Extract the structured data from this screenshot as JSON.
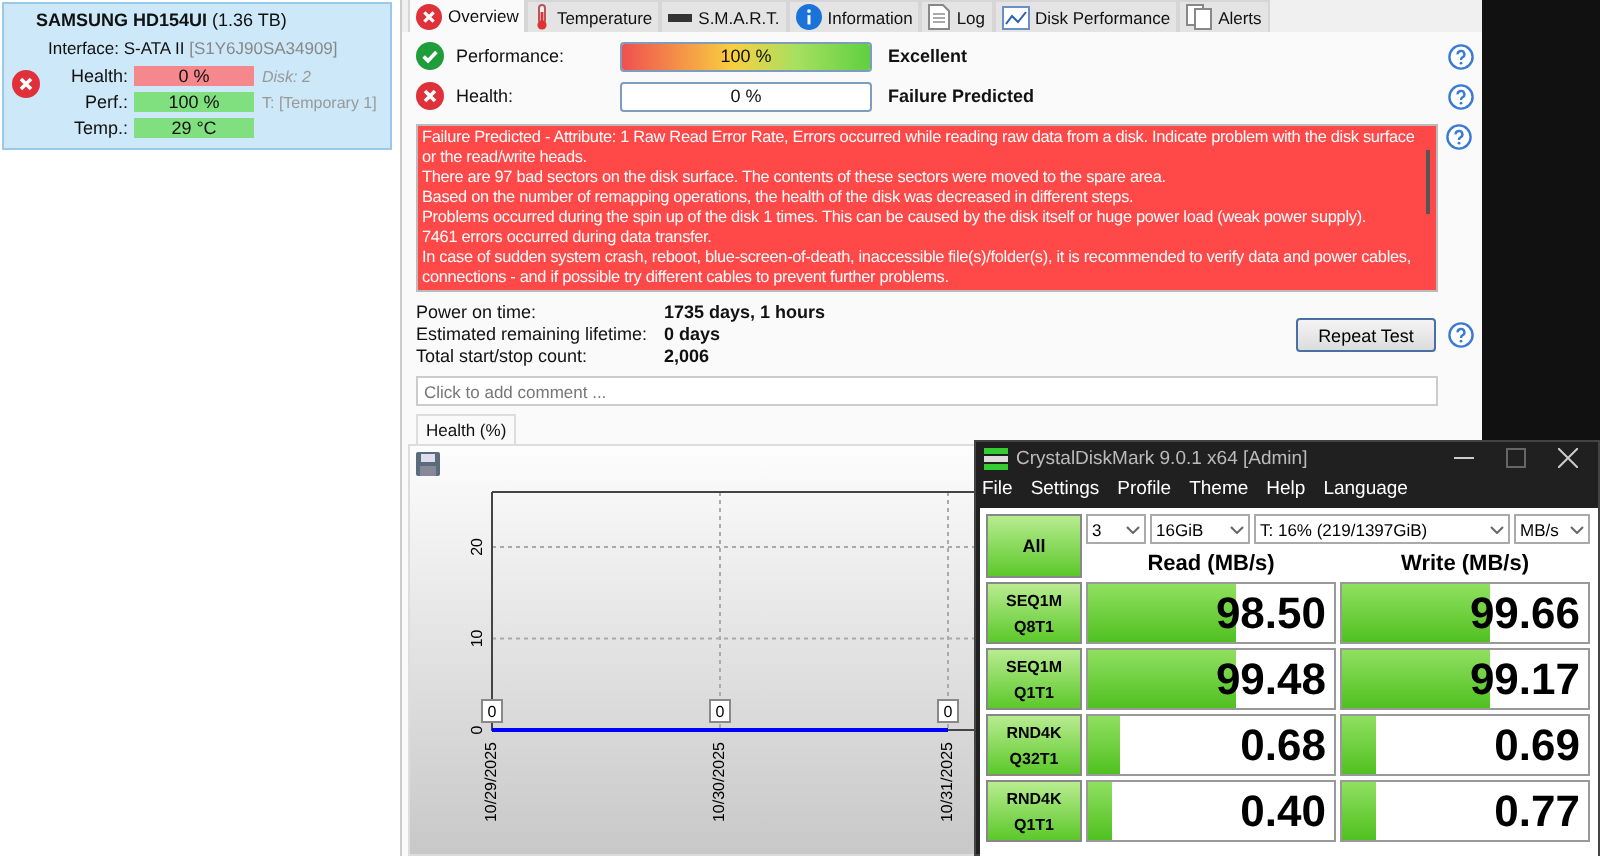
{
  "disk_card": {
    "failed": true,
    "model": "SAMSUNG HD154UI",
    "capacity": "(1.36 TB)",
    "interface_label": "Interface:",
    "interface": "S-ATA II",
    "serial": "[S1Y6J90SA34909]",
    "metrics": [
      {
        "label": "Health:",
        "value": "0 %",
        "color": "#f4888c",
        "note": "Disk: 2"
      },
      {
        "label": "Perf.:",
        "value": "100 %",
        "color": "#80e080",
        "note": "T: [Temporary 1]"
      },
      {
        "label": "Temp.:",
        "value": "29 °C",
        "color": "#80e080"
      }
    ]
  },
  "tabs": [
    {
      "label": "Overview",
      "selected": true
    },
    {
      "label": "Temperature",
      "selected": false
    },
    {
      "label": "S.M.A.R.T.",
      "selected": false
    },
    {
      "label": "Information",
      "selected": false
    },
    {
      "label": "Log",
      "selected": false
    },
    {
      "label": "Disk Performance",
      "selected": false
    },
    {
      "label": "Alerts",
      "selected": false
    }
  ],
  "overview": [
    {
      "label": "Performance:",
      "ok": true,
      "kind": "gradient",
      "value": "100 %",
      "level": 1,
      "verdict": "Excellent"
    },
    {
      "label": "Health:",
      "ok": false,
      "kind": "plain",
      "value": "0 %",
      "level": 0,
      "verdict": "Failure Predicted"
    }
  ],
  "message": {
    "lines": [
      "Failure Predicted - Attribute: 1 Raw Read Error Rate, Errors occurred while reading raw data from a disk. Indicate problem with the disk surface or the read/write heads.",
      "There are 97 bad sectors on the disk surface. The contents of these sectors were moved to the spare area.",
      "Based on the number of remapping operations, the health of the disk was decreased in different steps.",
      "Problems occurred during the spin up of the disk 1 times. This can be caused by the disk itself or huge power load (weak power supply).",
      "7461 errors occurred during data transfer.",
      "In case of sudden system crash, reboot, blue-screen-of-death, inaccessible file(s)/folder(s), it is recommended to verify data and power cables, connections - and if possible try different cables to prevent further problems."
    ]
  },
  "stats": [
    {
      "label": "Power on time:",
      "value": "1735 days, 1 hours"
    },
    {
      "label": "Estimated remaining lifetime:",
      "value": "0 days"
    },
    {
      "label": "Total start/stop count:",
      "value": "2,006"
    }
  ],
  "repeat_button": "Repeat Test",
  "comment": {
    "placeholder": "Click to add comment ..."
  },
  "history_tabs": [
    {
      "label": "Health (%)",
      "selected": true
    }
  ],
  "chart_data": {
    "type": "line",
    "categories": [
      "10/29/2025",
      "10/30/2025",
      "10/31/2025"
    ],
    "series": [
      {
        "color": "#0000ff",
        "values": [
          0,
          0,
          0
        ]
      }
    ],
    "ylim": [
      0,
      26
    ],
    "yticks": [
      0,
      10,
      20
    ],
    "grid": true,
    "data_labels": true
  },
  "benchmark": {
    "title": "CrystalDiskMark 9.0.1 x64 [Admin]",
    "menu": [
      "File",
      "Settings",
      "Profile",
      "Theme",
      "Help",
      "Language"
    ],
    "all_button": "All",
    "count": "3",
    "size": "16GiB",
    "drive": "T: 16% (219/1397GiB)",
    "unit": "MB/s",
    "read_header": "Read (MB/s)",
    "write_header": "Write (MB/s)",
    "tests": [
      {
        "name": "SEQ1M",
        "params": "Q8T1",
        "read": {
          "value": "98.50",
          "level": 0.6
        },
        "write": {
          "value": "99.66",
          "level": 0.6
        }
      },
      {
        "name": "SEQ1M",
        "params": "Q1T1",
        "read": {
          "value": "99.48",
          "level": 0.6
        },
        "write": {
          "value": "99.17",
          "level": 0.6
        }
      },
      {
        "name": "RND4K",
        "params": "Q32T1",
        "read": {
          "value": "0.68",
          "level": 0.13
        },
        "write": {
          "value": "0.69",
          "level": 0.14
        }
      },
      {
        "name": "RND4K",
        "params": "Q1T1",
        "read": {
          "value": "0.40",
          "level": 0.1
        },
        "write": {
          "value": "0.77",
          "level": 0.14
        }
      }
    ]
  }
}
